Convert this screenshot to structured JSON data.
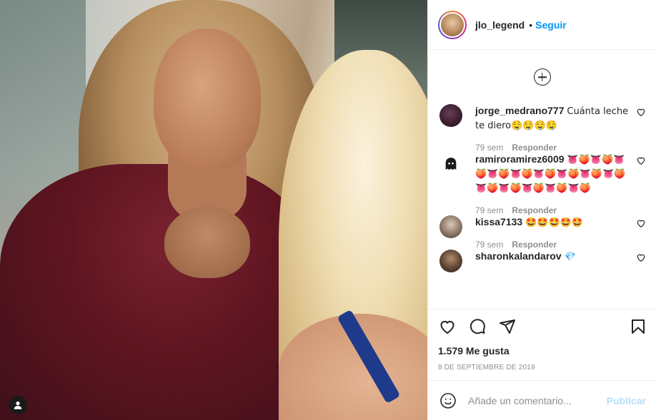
{
  "post": {
    "author": {
      "username": "jlo_legend",
      "separator": "•",
      "follow_label": "Seguir"
    },
    "photo": {
      "tag_icon": "user-tag-icon"
    },
    "load_more_icon": "plus-circle-icon",
    "comments": [
      {
        "username": "jorge_medrano777",
        "text": "Cuánta leche te diero🤤🤤🤤🤤",
        "time": "79 sem",
        "reply_label": "Responder"
      },
      {
        "username": "ramiroramirez6009",
        "text": "👅🍑👅🍑👅🍑👅🍑👅🍑👅🍑👅🍑👅🍑👅🍑👅🍑👅🍑👅🍑👅🍑👅🍑",
        "time": "79 sem",
        "reply_label": "Responder"
      },
      {
        "username": "kissa7133",
        "text": "🤩🤩🤩🤩🤩",
        "time": "79 sem",
        "reply_label": "Responder"
      },
      {
        "username": "sharonkalandarov",
        "text": "💎",
        "time": "",
        "reply_label": ""
      }
    ],
    "actions": {
      "like_icon": "heart-icon",
      "comment_icon": "comment-icon",
      "share_icon": "paper-plane-icon",
      "save_icon": "bookmark-icon"
    },
    "likes_label": "1.579 Me gusta",
    "date_label": "8 DE SEPTIEMBRE DE 2019",
    "add_comment": {
      "placeholder": "Añade un comentario...",
      "publish_label": "Publicar",
      "emoji_icon": "smiley-icon"
    }
  },
  "colors": {
    "accent": "#0095f6",
    "publish_disabled": "#b2dffc",
    "muted_text": "#8e8e8e",
    "primary_text": "#262626"
  }
}
